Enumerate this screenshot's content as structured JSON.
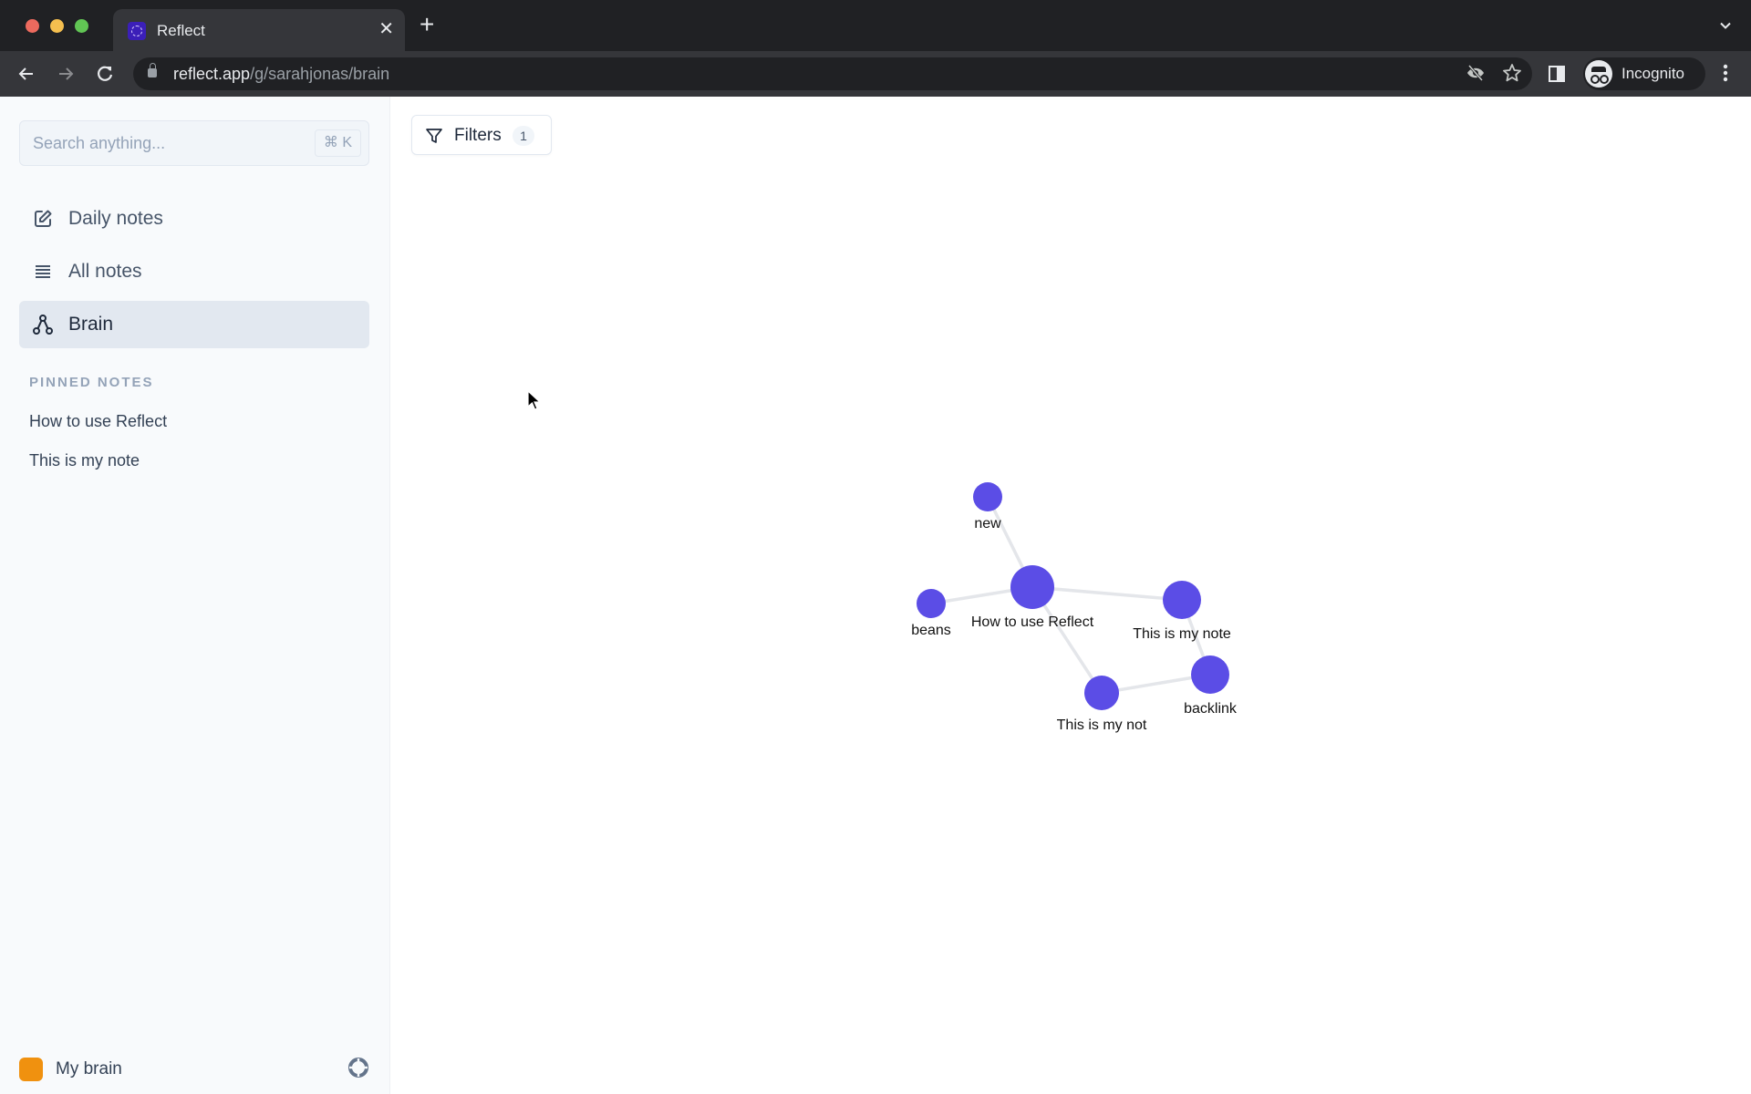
{
  "browser": {
    "tab": {
      "title": "Reflect",
      "favicon": "reflect-logo-icon"
    },
    "new_tab": "+",
    "close_tab": "✕",
    "tab_search_icon": "chevron-down-icon",
    "url_host": "reflect.app",
    "url_path": "/g/sarahjonas/brain",
    "profile_label": "Incognito",
    "icons": [
      "back-arrow-icon",
      "forward-arrow-icon",
      "reload-icon",
      "lock-icon",
      "eye-off-icon",
      "star-icon",
      "side-panel-icon",
      "incognito-icon",
      "kebab-menu-icon"
    ]
  },
  "sidebar": {
    "search": {
      "placeholder": "Search anything...",
      "shortcut": "⌘ K"
    },
    "nav": [
      {
        "label": "Daily notes",
        "icon": "edit-icon",
        "active": false
      },
      {
        "label": "All notes",
        "icon": "list-icon",
        "active": false
      },
      {
        "label": "Brain",
        "icon": "graph-icon",
        "active": true
      }
    ],
    "pinned_heading": "PINNED NOTES",
    "pinned": [
      {
        "label": "How to use Reflect"
      },
      {
        "label": "This is my note"
      }
    ],
    "footer": {
      "brain_label": "My brain",
      "brain_color": "#f0910f",
      "help_icon": "lifebuoy-icon"
    }
  },
  "main": {
    "filters": {
      "label": "Filters",
      "count": "1"
    }
  },
  "graph": {
    "node_color": "#5b4de6",
    "edge_color": "#e4e6ea",
    "nodes": [
      {
        "id": "new",
        "label": "new",
        "size": "small"
      },
      {
        "id": "howto",
        "label": "How to use Reflect",
        "size": "large"
      },
      {
        "id": "beans",
        "label": "beans",
        "size": "small"
      },
      {
        "id": "mynote",
        "label": "This is my note",
        "size": "medium"
      },
      {
        "id": "mynot",
        "label": "This is my not",
        "size": "medium-small"
      },
      {
        "id": "backlink",
        "label": "backlink",
        "size": "medium"
      }
    ],
    "edges": [
      [
        "new",
        "howto"
      ],
      [
        "beans",
        "howto"
      ],
      [
        "howto",
        "mynote"
      ],
      [
        "howto",
        "mynot"
      ],
      [
        "mynot",
        "backlink"
      ],
      [
        "mynote",
        "backlink"
      ]
    ]
  }
}
